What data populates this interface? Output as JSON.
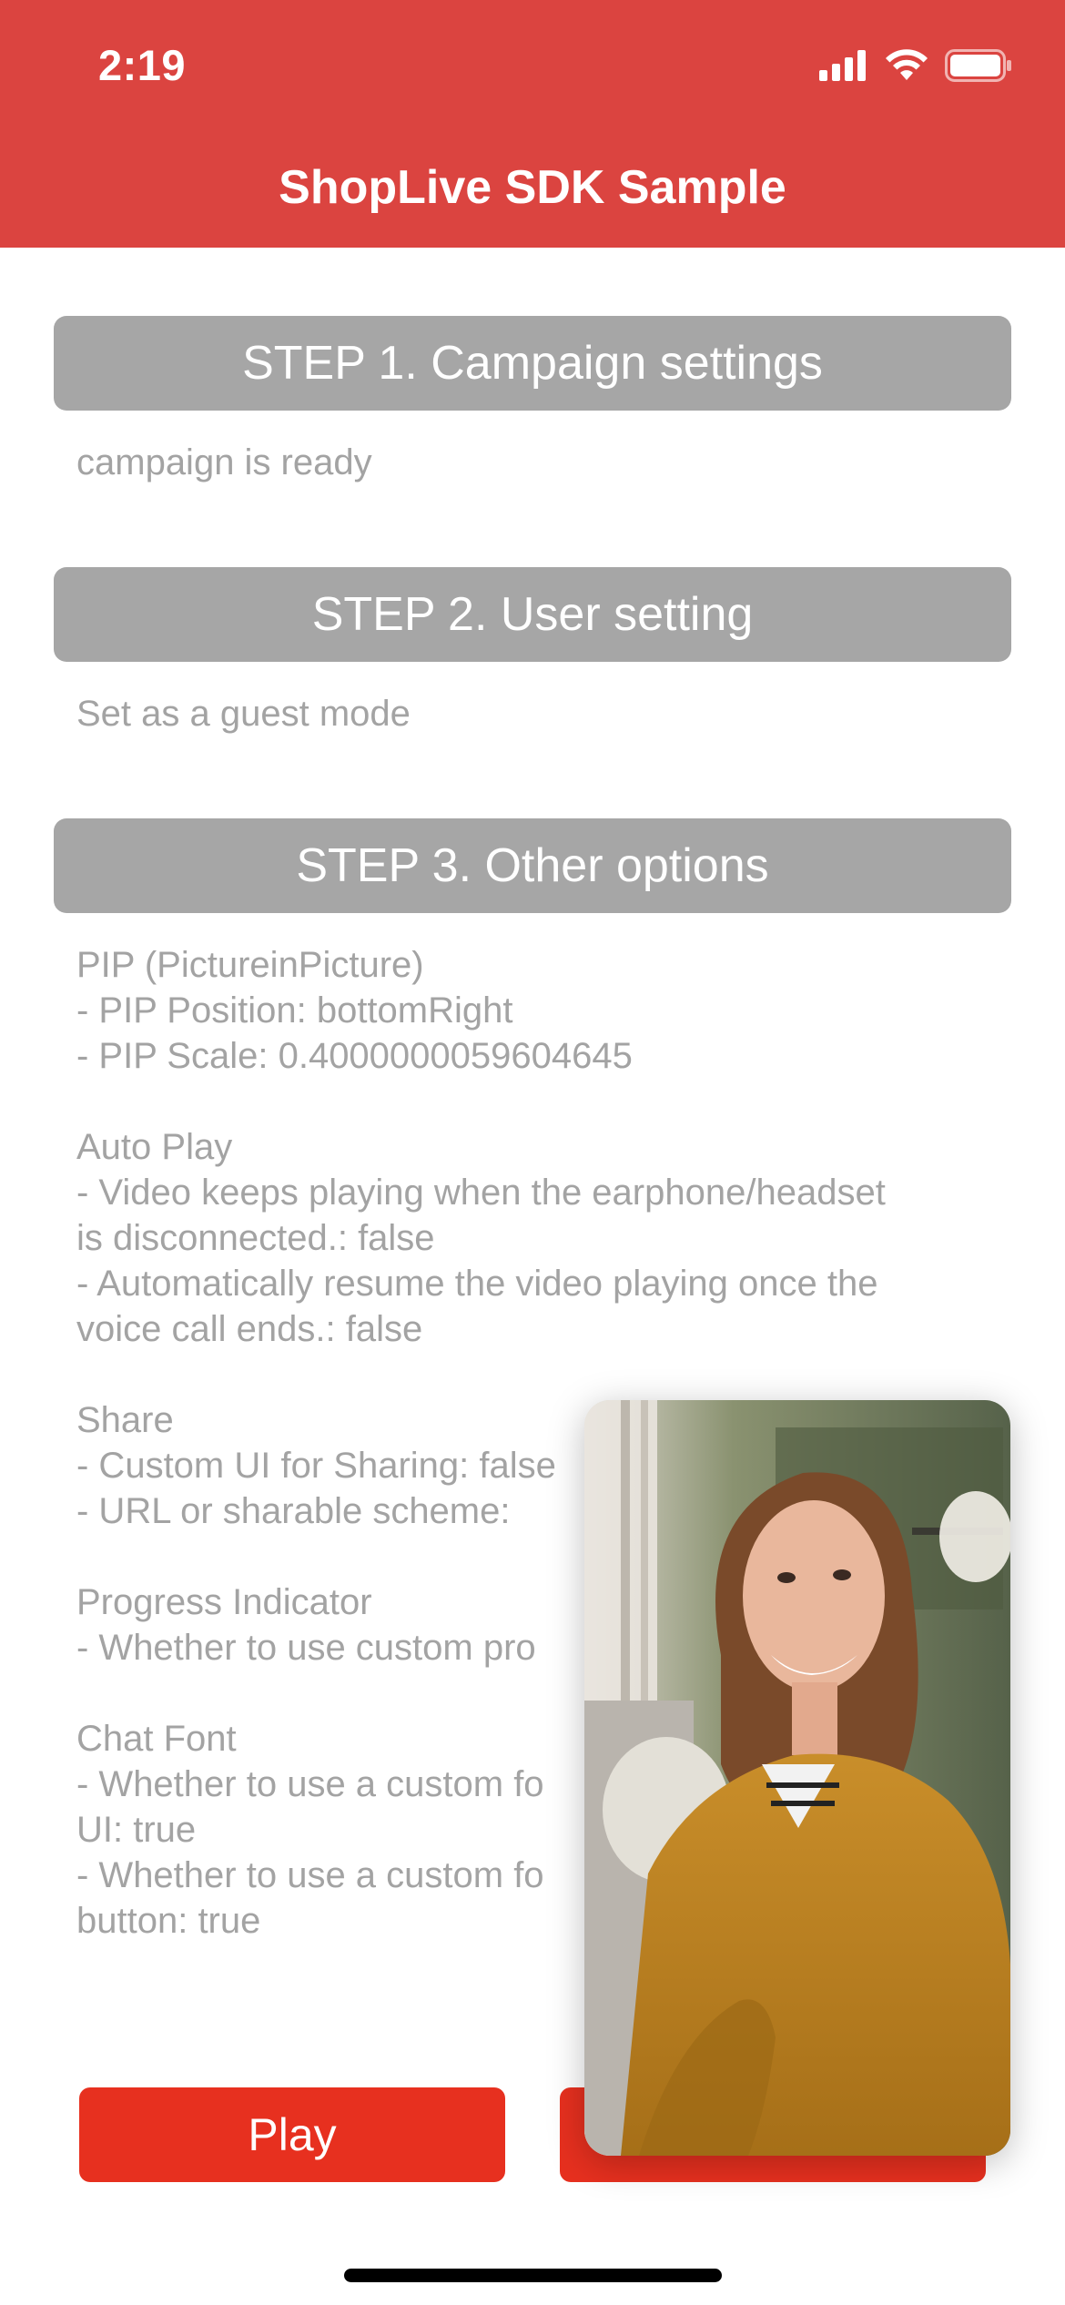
{
  "status_bar": {
    "time": "2:19",
    "icons": [
      "cellular-signal-icon",
      "wifi-icon",
      "battery-icon"
    ]
  },
  "header": {
    "title": "ShopLive SDK Sample",
    "background": "#DB4440"
  },
  "steps": [
    {
      "label": "STEP 1. Campaign settings",
      "description": "campaign is ready"
    },
    {
      "label": "STEP 2. User setting",
      "description": "Set as a guest mode"
    },
    {
      "label": "STEP 3. Other options"
    }
  ],
  "options_text": [
    "PIP (PictureinPicture)",
    "- PIP Position: bottomRight",
    "- PIP Scale: 0.4000000059604645",
    "",
    "Auto Play",
    "- Video keeps playing when the earphone/headset",
    "is disconnected.: false",
    "- Automatically resume the video playing once the",
    "voice call ends.: false",
    "",
    "Share",
    "- Custom UI for Sharing: false",
    "- URL or sharable scheme:",
    "",
    "Progress Indicator",
    "- Whether to use custom pro",
    "",
    "Chat Font",
    "- Whether to use a custom fo",
    "UI: true",
    "- Whether to use a custom fo",
    "button: true"
  ],
  "buttons": {
    "play": "Play",
    "preview": ""
  },
  "pip": {
    "description": "live video preview"
  },
  "colors": {
    "accent": "#E7301F",
    "step_button": "#A6A6A6",
    "muted_text": "#A3A3A3"
  }
}
